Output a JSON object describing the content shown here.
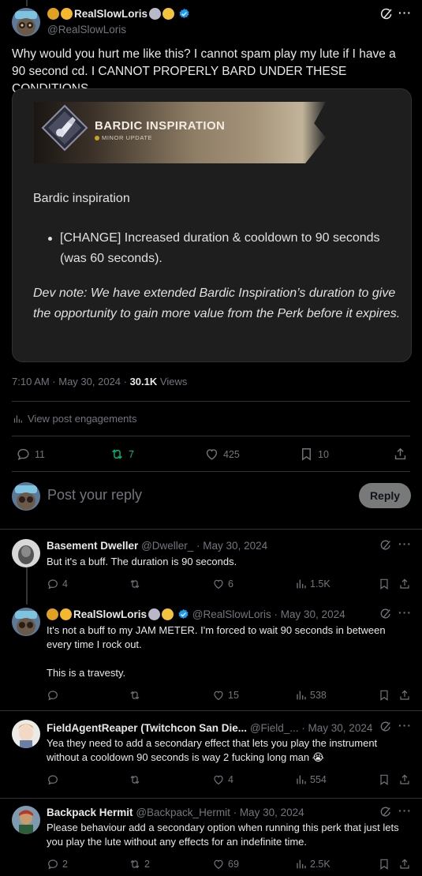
{
  "main_post": {
    "author_name": "RealSlowLoris",
    "handle": "@RealSlowLoris",
    "text": "Why would you hurt me like this? I cannot spam play my lute if I have a 90 second cd. I CANNOT PROPERLY BARD UNDER THESE CONDITIONS.",
    "media": {
      "banner_title": "BARDIC INSPIRATION",
      "banner_subtitle": "MINOR UPDATE",
      "heading": "Bardic inspiration",
      "bullet": "[CHANGE] Increased duration & cooldown to 90 seconds (was 60 seconds).",
      "dev_note": "Dev note: We have extended Bardic Inspiration’s duration to give the opportunity to gain more value from the Perk before it expires."
    },
    "time": "7:10 AM · May 30, 2024 · ",
    "views_count": "30.1K",
    "views_label": " Views",
    "engagements_label": "View post engagements",
    "replies": "11",
    "reposts": "7",
    "likes": "425",
    "bookmarks": "10"
  },
  "composer": {
    "placeholder": "Post your reply",
    "button_label": "Reply"
  },
  "replies": [
    {
      "name": "Basement Dweller",
      "handle": "@Dweller_ · May 30, 2024",
      "text": "But it's a buff. The duration is 90 seconds.",
      "replies": "4",
      "reposts": "",
      "likes": "6",
      "views": "1.5K"
    },
    {
      "name": "RealSlowLoris",
      "handle": "@RealSlowLoris · May 30, 2024",
      "text_1": "It's not a buff to my JAM METER. I'm forced to wait 90 seconds in between every time I rock out.",
      "text_2": "This is a travesty.",
      "replies": "",
      "reposts": "",
      "likes": "15",
      "views": "538"
    },
    {
      "name": "FieldAgentReaper (Twitchcon San Die...",
      "handle": "@Field_... · May 30, 2024",
      "text": "Yea they need to add a secondary effect that lets you play the instrument without a cooldown 90 seconds is way 2 fucking long man 😭",
      "replies": "",
      "reposts": "",
      "likes": "4",
      "views": "554"
    },
    {
      "name": "Backpack Hermit",
      "handle": "@Backpack_Hermit · May 30, 2024",
      "text": "Please behaviour add a secondary option when running this perk that just lets you play the lute without any effects for an indefinite time.",
      "replies": "2",
      "reposts": "2",
      "likes": "69",
      "views": "2.5K"
    }
  ],
  "colors": {
    "background": "#000000",
    "text": "#e7e9ea",
    "muted": "#71767b",
    "verified": "#1d9bf0",
    "repost_active": "#00ba7c",
    "border": "#2f3336"
  },
  "icons": [
    "grok-icon",
    "more-icon",
    "verified-badge-icon",
    "reply-icon",
    "repost-icon",
    "like-icon",
    "bookmark-icon",
    "share-icon",
    "views-icon"
  ]
}
